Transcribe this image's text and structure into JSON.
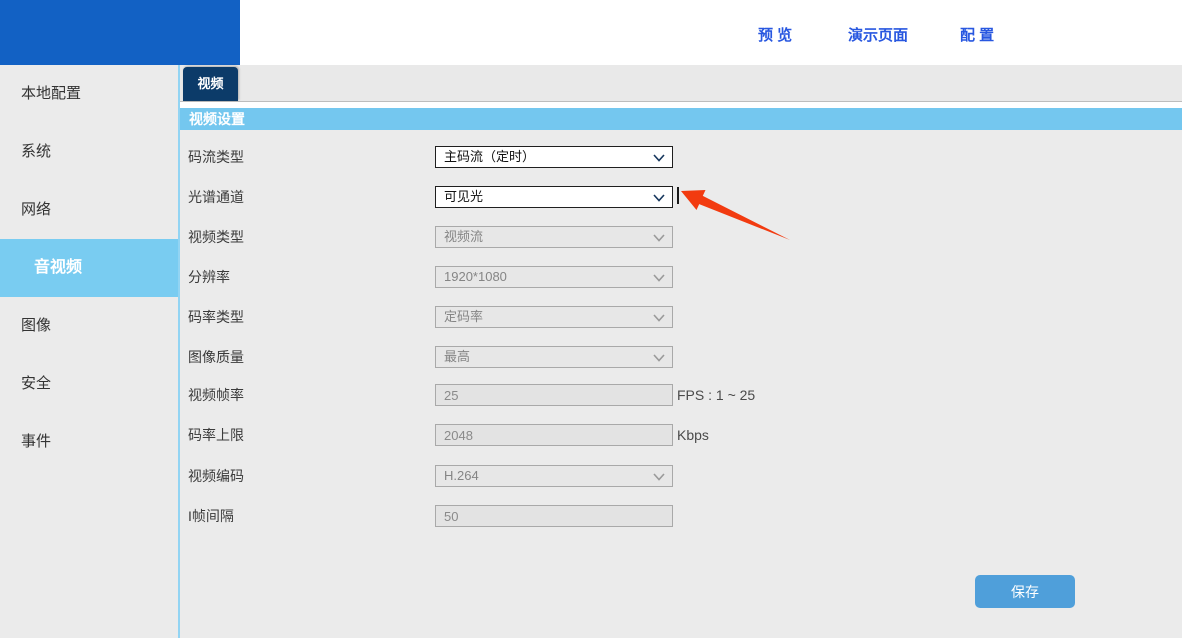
{
  "header": {
    "links": [
      {
        "name": "preview",
        "label": "预 览"
      },
      {
        "name": "demo-page",
        "label": "演示页面"
      },
      {
        "name": "config",
        "label": "配 置"
      }
    ]
  },
  "sidebar": {
    "items": [
      {
        "name": "local-config",
        "label": "本地配置",
        "active": false
      },
      {
        "name": "system",
        "label": "系统",
        "active": false
      },
      {
        "name": "network",
        "label": "网络",
        "active": false
      },
      {
        "name": "audio-video",
        "label": "音视频",
        "active": true
      },
      {
        "name": "image",
        "label": "图像",
        "active": false
      },
      {
        "name": "security",
        "label": "安全",
        "active": false
      },
      {
        "name": "event",
        "label": "事件",
        "active": false
      }
    ]
  },
  "main": {
    "tab_label": "视频",
    "section_title": "视频设置",
    "form": {
      "rows": [
        {
          "name": "stream-type",
          "label": "码流类型",
          "type": "select",
          "value": "主码流（定时）",
          "enabled": true,
          "suffix": ""
        },
        {
          "name": "spectrum-channel",
          "label": "光谱通道",
          "type": "select",
          "value": "可见光",
          "enabled": true,
          "suffix": ""
        },
        {
          "name": "video-type",
          "label": "视频类型",
          "type": "select",
          "value": "视频流",
          "enabled": false,
          "suffix": ""
        },
        {
          "name": "resolution",
          "label": "分辨率",
          "type": "select",
          "value": "1920*1080",
          "enabled": false,
          "suffix": ""
        },
        {
          "name": "bitrate-type",
          "label": "码率类型",
          "type": "select",
          "value": "定码率",
          "enabled": false,
          "suffix": ""
        },
        {
          "name": "image-quality",
          "label": "图像质量",
          "type": "select",
          "value": "最高",
          "enabled": false,
          "suffix": ""
        },
        {
          "name": "frame-rate",
          "label": "视频帧率",
          "type": "input",
          "value": "25",
          "enabled": false,
          "suffix": "FPS : 1 ~ 25"
        },
        {
          "name": "max-bitrate",
          "label": "码率上限",
          "type": "input",
          "value": "2048",
          "enabled": false,
          "suffix": "Kbps"
        },
        {
          "name": "video-encoding",
          "label": "视频编码",
          "type": "select",
          "value": "H.264",
          "enabled": false,
          "suffix": ""
        },
        {
          "name": "i-frame-interval",
          "label": "I帧间隔",
          "type": "input",
          "value": "50",
          "enabled": false,
          "suffix": ""
        }
      ],
      "save_label": "保存"
    }
  },
  "colors": {
    "logo_blue": "#1261c4",
    "link_blue": "#2857e0",
    "tab_navy": "#0c3b69",
    "section_bar_blue": "#74c7ef",
    "sidebar_active_blue": "#79ccf1",
    "save_button_blue": "#4f9fda",
    "annotation_arrow_red": "#f23b10"
  }
}
